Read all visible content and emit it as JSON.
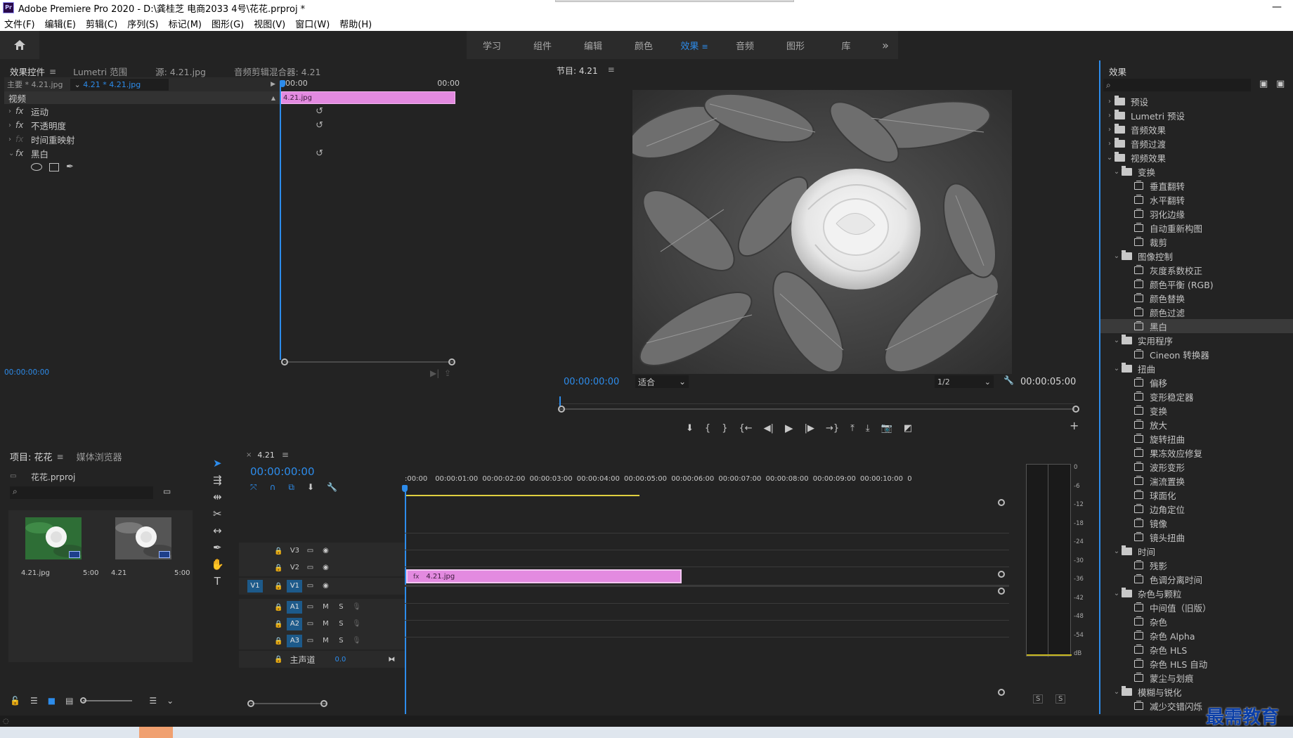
{
  "window": {
    "app_logo": "Pr",
    "title": "Adobe Premiere Pro 2020 - D:\\龚桂芝 电商2033 4号\\花花.prproj *"
  },
  "menu": [
    "文件(F)",
    "编辑(E)",
    "剪辑(C)",
    "序列(S)",
    "标记(M)",
    "图形(G)",
    "视图(V)",
    "窗口(W)",
    "帮助(H)"
  ],
  "workspaces": {
    "tabs": [
      "学习",
      "组件",
      "编辑",
      "颜色",
      "效果",
      "音频",
      "图形",
      "库"
    ],
    "active": "效果",
    "more": "»"
  },
  "effect_controls": {
    "tabs": [
      "效果控件",
      "Lumetri 范围",
      "源: 4.21.jpg",
      "音频剪辑混合器: 4.21"
    ],
    "master": "主要 * 4.21.jpg",
    "sequence_clip": "4.21 * 4.21.jpg",
    "section": "视频",
    "effects": [
      {
        "name": "运动",
        "enabled": true
      },
      {
        "name": "不透明度",
        "enabled": true
      },
      {
        "name": "时间重映射",
        "enabled": false
      },
      {
        "name": "黑白",
        "enabled": true
      }
    ],
    "mini_timeline": {
      "start": "00:00",
      "end": "00:00",
      "clip": "4.21.jpg"
    },
    "timecode": "00:00:00:00"
  },
  "program_monitor": {
    "title": "节目: 4.21",
    "timecode": "00:00:00:00",
    "fit": "适合",
    "resolution": "1/2",
    "duration": "00:00:05:00"
  },
  "effects_panel": {
    "title": "效果",
    "search_placeholder": "",
    "items": [
      {
        "label": "预设",
        "type": "folder",
        "level": 0,
        "open": false
      },
      {
        "label": "Lumetri 预设",
        "type": "folder",
        "level": 0,
        "open": false
      },
      {
        "label": "音频效果",
        "type": "folder",
        "level": 0,
        "open": false
      },
      {
        "label": "音频过渡",
        "type": "folder",
        "level": 0,
        "open": false
      },
      {
        "label": "视频效果",
        "type": "folder",
        "level": 0,
        "open": true
      },
      {
        "label": "变换",
        "type": "folder",
        "level": 1,
        "open": true
      },
      {
        "label": "垂直翻转",
        "type": "effect",
        "level": 2
      },
      {
        "label": "水平翻转",
        "type": "effect",
        "level": 2
      },
      {
        "label": "羽化边缘",
        "type": "effect",
        "level": 2
      },
      {
        "label": "自动重新构图",
        "type": "effect",
        "level": 2
      },
      {
        "label": "裁剪",
        "type": "effect",
        "level": 2
      },
      {
        "label": "图像控制",
        "type": "folder",
        "level": 1,
        "open": true
      },
      {
        "label": "灰度系数校正",
        "type": "effect",
        "level": 2
      },
      {
        "label": "颜色平衡 (RGB)",
        "type": "effect",
        "level": 2
      },
      {
        "label": "颜色替换",
        "type": "effect",
        "level": 2
      },
      {
        "label": "颜色过滤",
        "type": "effect",
        "level": 2
      },
      {
        "label": "黑白",
        "type": "effect",
        "level": 2,
        "selected": true
      },
      {
        "label": "实用程序",
        "type": "folder",
        "level": 1,
        "open": true
      },
      {
        "label": "Cineon 转换器",
        "type": "effect",
        "level": 2
      },
      {
        "label": "扭曲",
        "type": "folder",
        "level": 1,
        "open": true
      },
      {
        "label": "偏移",
        "type": "effect",
        "level": 2
      },
      {
        "label": "变形稳定器",
        "type": "effect",
        "level": 2
      },
      {
        "label": "变换",
        "type": "effect",
        "level": 2
      },
      {
        "label": "放大",
        "type": "effect",
        "level": 2
      },
      {
        "label": "旋转扭曲",
        "type": "effect",
        "level": 2
      },
      {
        "label": "果冻效应修复",
        "type": "effect",
        "level": 2
      },
      {
        "label": "波形变形",
        "type": "effect",
        "level": 2
      },
      {
        "label": "湍流置换",
        "type": "effect",
        "level": 2
      },
      {
        "label": "球面化",
        "type": "effect",
        "level": 2
      },
      {
        "label": "边角定位",
        "type": "effect",
        "level": 2
      },
      {
        "label": "镜像",
        "type": "effect",
        "level": 2
      },
      {
        "label": "镜头扭曲",
        "type": "effect",
        "level": 2
      },
      {
        "label": "时间",
        "type": "folder",
        "level": 1,
        "open": true
      },
      {
        "label": "残影",
        "type": "effect",
        "level": 2
      },
      {
        "label": "色调分离时间",
        "type": "effect",
        "level": 2
      },
      {
        "label": "杂色与颗粒",
        "type": "folder",
        "level": 1,
        "open": true
      },
      {
        "label": "中间值（旧版）",
        "type": "effect",
        "level": 2
      },
      {
        "label": "杂色",
        "type": "effect",
        "level": 2
      },
      {
        "label": "杂色 Alpha",
        "type": "effect",
        "level": 2
      },
      {
        "label": "杂色 HLS",
        "type": "effect",
        "level": 2
      },
      {
        "label": "杂色 HLS 自动",
        "type": "effect",
        "level": 2
      },
      {
        "label": "蒙尘与划痕",
        "type": "effect",
        "level": 2
      },
      {
        "label": "模糊与锐化",
        "type": "folder",
        "level": 1,
        "open": true
      },
      {
        "label": "减少交错闪烁",
        "type": "effect",
        "level": 2
      }
    ]
  },
  "project": {
    "tabs": [
      "项目: 花花",
      "媒体浏览器"
    ],
    "file": "花花.prproj",
    "items": [
      {
        "name": "4.21.jpg",
        "duration": "5:00",
        "kind": "color"
      },
      {
        "name": "4.21",
        "duration": "5:00",
        "kind": "gray"
      }
    ]
  },
  "timeline": {
    "sequence": "4.21",
    "timecode": "00:00:00:00",
    "ruler": [
      ":00:00",
      "00:00:01:00",
      "00:00:02:00",
      "00:00:03:00",
      "00:00:04:00",
      "00:00:05:00",
      "00:00:06:00",
      "00:00:07:00",
      "00:00:08:00",
      "00:00:09:00",
      "00:00:10:00",
      "0"
    ],
    "video_tracks": [
      "V3",
      "V2",
      "V1"
    ],
    "source_patch": "V1",
    "audio_tracks": [
      "A1",
      "A2",
      "A3"
    ],
    "mute": "M",
    "solo": "S",
    "master": {
      "label": "主声道",
      "value": "0.0"
    },
    "clip": "4.21.jpg"
  },
  "audio_meter": {
    "scale": [
      "0",
      "-6",
      "-12",
      "-18",
      "-24",
      "-30",
      "-36",
      "-42",
      "-48",
      "-54",
      "dB"
    ],
    "solo": [
      "S",
      "S"
    ]
  },
  "watermark": "最需教育",
  "colors": {
    "accent": "#2d8ceb",
    "clip": "#e38ae0",
    "bg": "#232323"
  }
}
